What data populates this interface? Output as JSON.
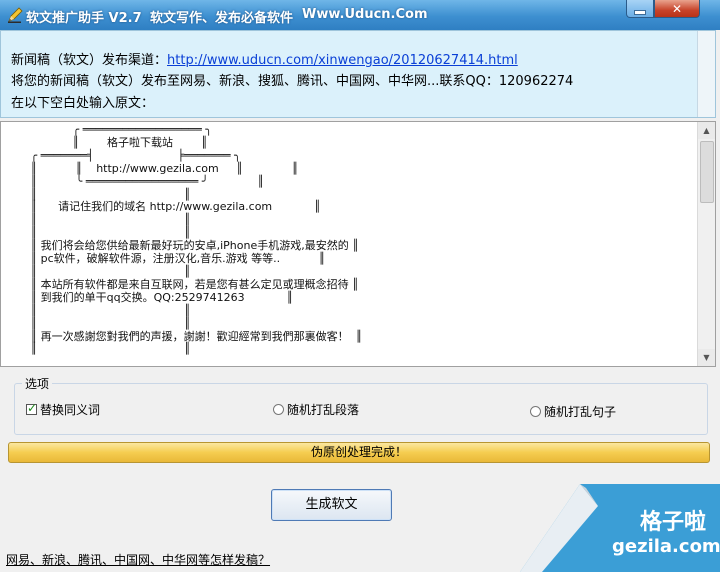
{
  "window": {
    "title_parts": [
      "软文推广助手 V2.7",
      "软文写作、发布必备软件",
      "Www.Uducn.Com"
    ],
    "min_icon": "minimize-icon",
    "close_icon": "close-icon",
    "close_glyph": "✕"
  },
  "info": {
    "channel_label": "新闻稿（软文）发布渠道：",
    "channel_url": "http://www.uducn.com/xinwengao/20120627414.html",
    "publish_line": "将您的新闻稿（软文）发布至网易、新浪、搜狐、腾讯、中国网、中华网...联系QQ：120962274",
    "prompt_line": "在以下空白处输入原文："
  },
  "editor": {
    "lines": [
      "             ╭ ══════════════════ ╮",
      "             ║        格子啦下载站        ║",
      " ╭ ═══════╡                        ╞═══════ ╮",
      " ║           ║    http://www.gezila.com     ║              ║",
      " ║           ╰ ═════════════════ ╯              ║",
      " ║                                          ║",
      " ║      请记住我们的域名 http://www.gezila.com            ║",
      " ║                                          ║",
      " ║                                          ║",
      " ║ 我们将会给您供给最新最好玩的安卓,iPhone手机游戏,最安然的 ║",
      " ║ pc软件，破解软件源，注册汉化,音乐.游戏 等等..           ║",
      " ║                                          ║",
      " ║ 本站所有软件都是来自互联网，若是您有甚么定见或理概念招待 ║",
      " ║ 到我们的单干qq交换。QQ:2529741263            ║",
      " ║                                          ║",
      " ║                                          ║",
      " ║ 再一次感謝您對我們的声援，謝謝！歡迎經常到我們那裏做客！  ║",
      " ║                                          ║"
    ]
  },
  "options": {
    "group_title": "选项",
    "synonym_label": "替换同义词",
    "synonym_checked": true,
    "shuffle_paragraphs_label": "随机打乱段落",
    "shuffle_sentences_label": "随机打乱句子"
  },
  "status": {
    "text": "伪原创处理完成！"
  },
  "actions": {
    "generate_label": "生成软文"
  },
  "footer": {
    "link_text": "网易、新浪、腾讯、中国网、中华网等怎样发稿？"
  },
  "watermark": {
    "line1": "格子啦",
    "line2": "gezila.com"
  },
  "colors": {
    "titlebar": "#3d8fd0",
    "info_bg": "#dbf1fb",
    "status_bar": "#f5cd50",
    "link": "#0a3fd6",
    "watermark": "#3b9ed6"
  }
}
